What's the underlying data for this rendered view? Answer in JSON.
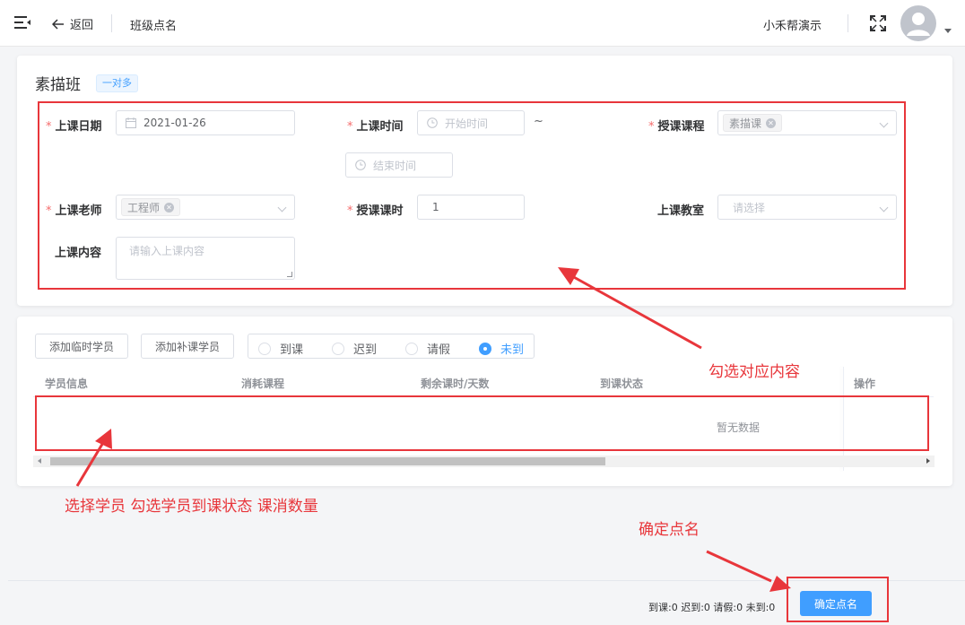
{
  "header": {
    "back_label": "返回",
    "breadcrumb": "班级点名",
    "org_name": "小禾帮演示"
  },
  "class_info": {
    "name": "素描班",
    "type_tag": "一对多"
  },
  "form": {
    "date_label": "上课日期",
    "date_value": "2021-01-26",
    "time_label": "上课时间",
    "start_placeholder": "开始时间",
    "range_sep": "~",
    "end_placeholder": "结束时间",
    "course_label": "授课课程",
    "course_tag": "素描课",
    "teacher_label": "上课老师",
    "teacher_tag": "工程师",
    "hours_label": "授课课时",
    "hours_value": "1",
    "room_label": "上课教室",
    "room_placeholder": "请选择",
    "content_label": "上课内容",
    "content_placeholder": "请输入上课内容",
    "required_mark": "*"
  },
  "students": {
    "add_temp_label": "添加临时学员",
    "add_makeup_label": "添加补课学员",
    "status_options": [
      "到课",
      "迟到",
      "请假",
      "未到"
    ],
    "selected_status": "未到",
    "columns": [
      "学员信息",
      "消耗课程",
      "剩余课时/天数",
      "到课状态",
      "操作"
    ],
    "empty_text": "暂无数据"
  },
  "footer": {
    "stats": "到课:0  迟到:0  请假:0    未到:0",
    "confirm_label": "确定点名"
  },
  "annotations": {
    "form_note": "勾选对应内容",
    "student_note": "选择学员 勾选学员到课状态 课消数量",
    "confirm_note": "确定点名"
  },
  "colors": {
    "primary": "#409eff",
    "annotation": "#e8363b",
    "required": "#f56c6c"
  }
}
